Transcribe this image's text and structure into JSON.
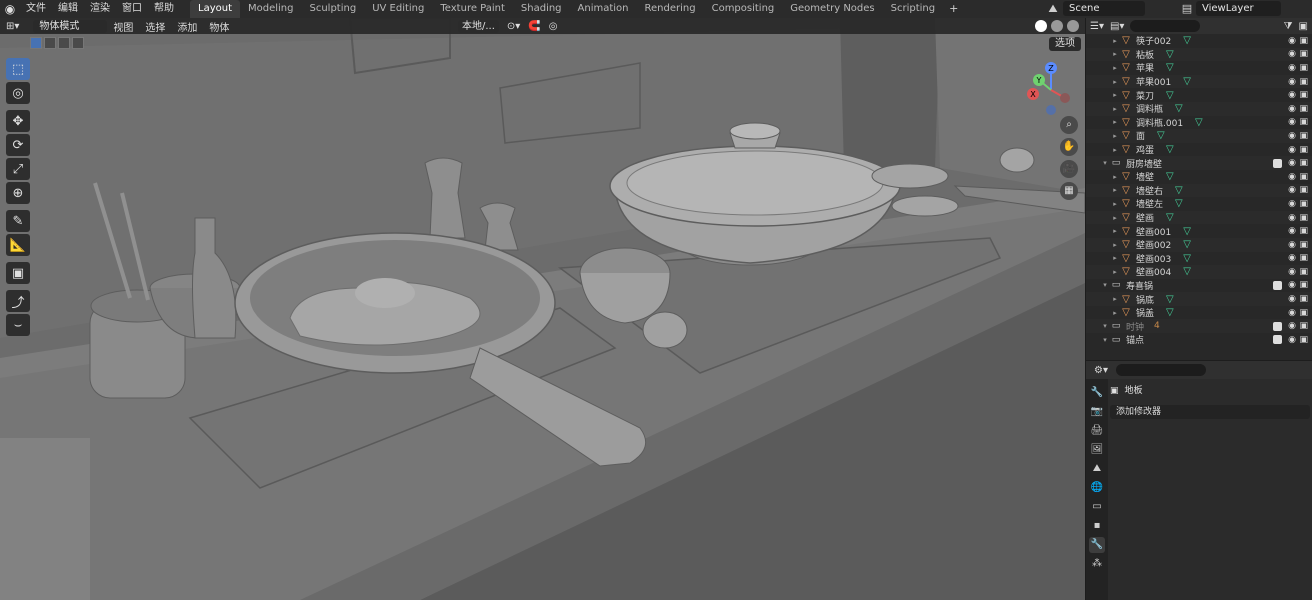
{
  "topbar": {
    "menu": [
      "文件",
      "编辑",
      "渲染",
      "窗口",
      "帮助"
    ],
    "workspaces": [
      "Layout",
      "Modeling",
      "Sculpting",
      "UV Editing",
      "Texture Paint",
      "Shading",
      "Animation",
      "Rendering",
      "Compositing",
      "Geometry Nodes",
      "Scripting"
    ],
    "active_workspace": "Layout",
    "add_label": "+",
    "scene": "Scene",
    "view_layer": "ViewLayer"
  },
  "viewport": {
    "mode": "物体模式",
    "menus": [
      "视图",
      "选择",
      "添加",
      "物体"
    ],
    "transform_orientation": "本地/...",
    "options_label": "选项",
    "gizmo_axes": [
      "X",
      "Y",
      "Z"
    ]
  },
  "outliner": {
    "rows": [
      {
        "name": "筷子002",
        "type": "object",
        "indent": 2
      },
      {
        "name": "粘板",
        "type": "object",
        "indent": 2
      },
      {
        "name": "苹果",
        "type": "object",
        "indent": 2
      },
      {
        "name": "苹果001",
        "type": "object",
        "indent": 2
      },
      {
        "name": "菜刀",
        "type": "object",
        "indent": 2
      },
      {
        "name": "调料瓶",
        "type": "object",
        "indent": 2
      },
      {
        "name": "调料瓶.001",
        "type": "object",
        "indent": 2
      },
      {
        "name": "面",
        "type": "object",
        "indent": 2
      },
      {
        "name": "鸡蛋",
        "type": "object",
        "indent": 2
      },
      {
        "name": "厨房墙壁",
        "type": "collection",
        "indent": 1
      },
      {
        "name": "墙壁",
        "type": "object",
        "indent": 2
      },
      {
        "name": "墙壁右",
        "type": "object",
        "indent": 2
      },
      {
        "name": "墙壁左",
        "type": "object",
        "indent": 2
      },
      {
        "name": "壁画",
        "type": "object",
        "indent": 2
      },
      {
        "name": "壁画001",
        "type": "object",
        "indent": 2
      },
      {
        "name": "壁画002",
        "type": "object",
        "indent": 2
      },
      {
        "name": "壁画003",
        "type": "object",
        "indent": 2
      },
      {
        "name": "壁画004",
        "type": "object",
        "indent": 2
      },
      {
        "name": "寿喜锅",
        "type": "collection",
        "indent": 1
      },
      {
        "name": "锅底",
        "type": "object",
        "indent": 2
      },
      {
        "name": "锅盖",
        "type": "object",
        "indent": 2
      },
      {
        "name": "时钟",
        "type": "collection",
        "indent": 1,
        "dim": true
      },
      {
        "name": "锚点",
        "type": "collection",
        "indent": 1
      }
    ],
    "clock_count": "4"
  },
  "properties": {
    "object_name": "地板",
    "add_modifier": "添加修改器"
  }
}
